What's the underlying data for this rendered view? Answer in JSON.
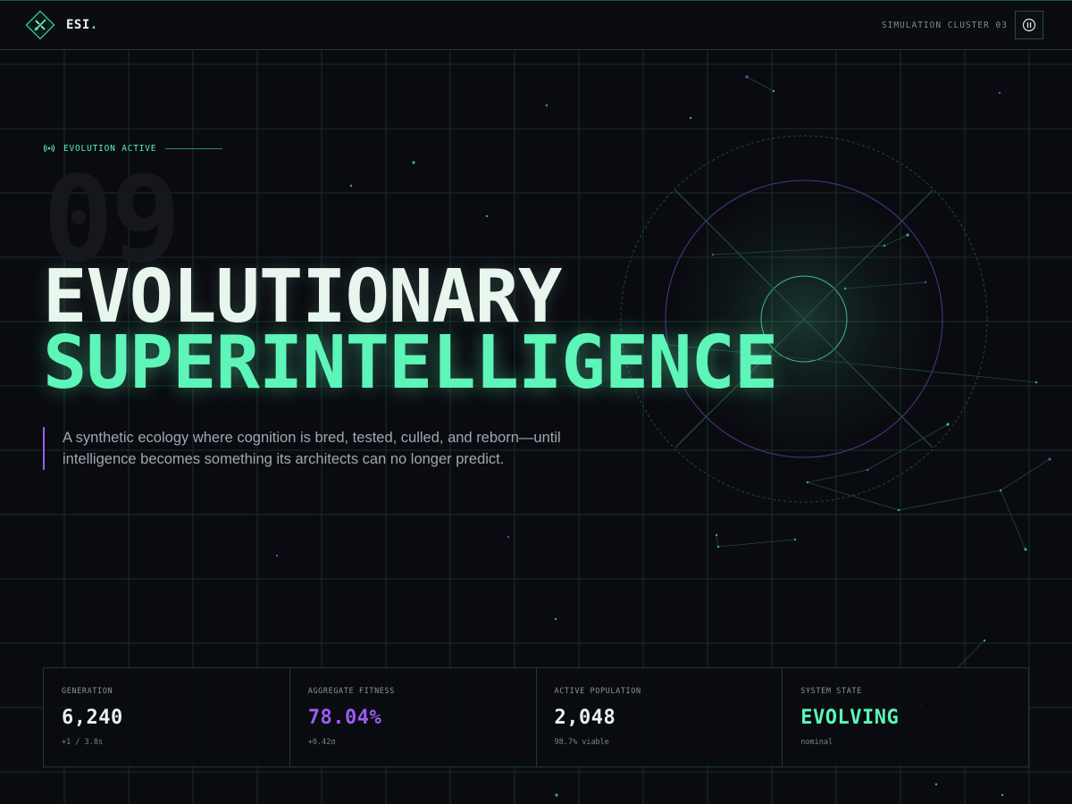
{
  "header": {
    "logo_text": "ESI",
    "logo_dot": ".",
    "cluster_label": "SIMULATION CLUSTER 03",
    "pause_icon": "pause-icon"
  },
  "hero": {
    "status": "EVOLUTION ACTIVE",
    "status_icon": "broadcast-icon",
    "ghost_number": "09",
    "headline_line1": "EVOLUTIONARY",
    "headline_line2": "SUPERINTELLIGENCE",
    "description": "A synthetic ecology where cognition is bred, tested, culled, and reborn—until intelligence becomes something its architects can no longer predict."
  },
  "stats": [
    {
      "label": "GENERATION",
      "value": "6,240",
      "sub": "+1 / 3.8s",
      "color": "#e8f1ee"
    },
    {
      "label": "AGGREGATE FITNESS",
      "value": "78.04%",
      "sub": "+0.42σ",
      "color": "#9b5cf2"
    },
    {
      "label": "ACTIVE POPULATION",
      "value": "2,048",
      "sub": "98.7% viable",
      "color": "#e8f1ee"
    },
    {
      "label": "SYSTEM STATE",
      "value": "EVOLVING",
      "sub": "nominal",
      "color": "#5ef5b8"
    }
  ],
  "colors": {
    "accent_green": "#5ef5b8",
    "accent_purple": "#9b5cf2",
    "background": "#0a0b10",
    "grid": "#13302a"
  }
}
